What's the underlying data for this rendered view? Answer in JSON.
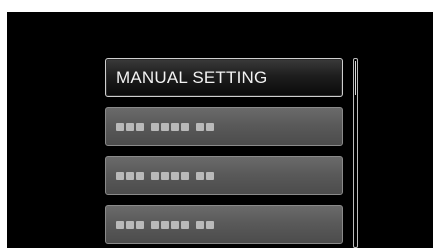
{
  "menu": {
    "items": [
      {
        "label": "MANUAL SETTING",
        "selected": true
      },
      {
        "label": "",
        "selected": false,
        "placeholder_groups": [
          3,
          4,
          2
        ]
      },
      {
        "label": "",
        "selected": false,
        "placeholder_groups": [
          3,
          4,
          2
        ]
      },
      {
        "label": "",
        "selected": false,
        "placeholder_groups": [
          3,
          4,
          2
        ]
      }
    ]
  },
  "scrollbar": {
    "visible": true,
    "position_fraction": 0.0
  },
  "colors": {
    "background": "#000000",
    "item_fill": "#5a5a5a",
    "selected_fill": "#1e1e1e",
    "text": "#f2f2f2"
  }
}
